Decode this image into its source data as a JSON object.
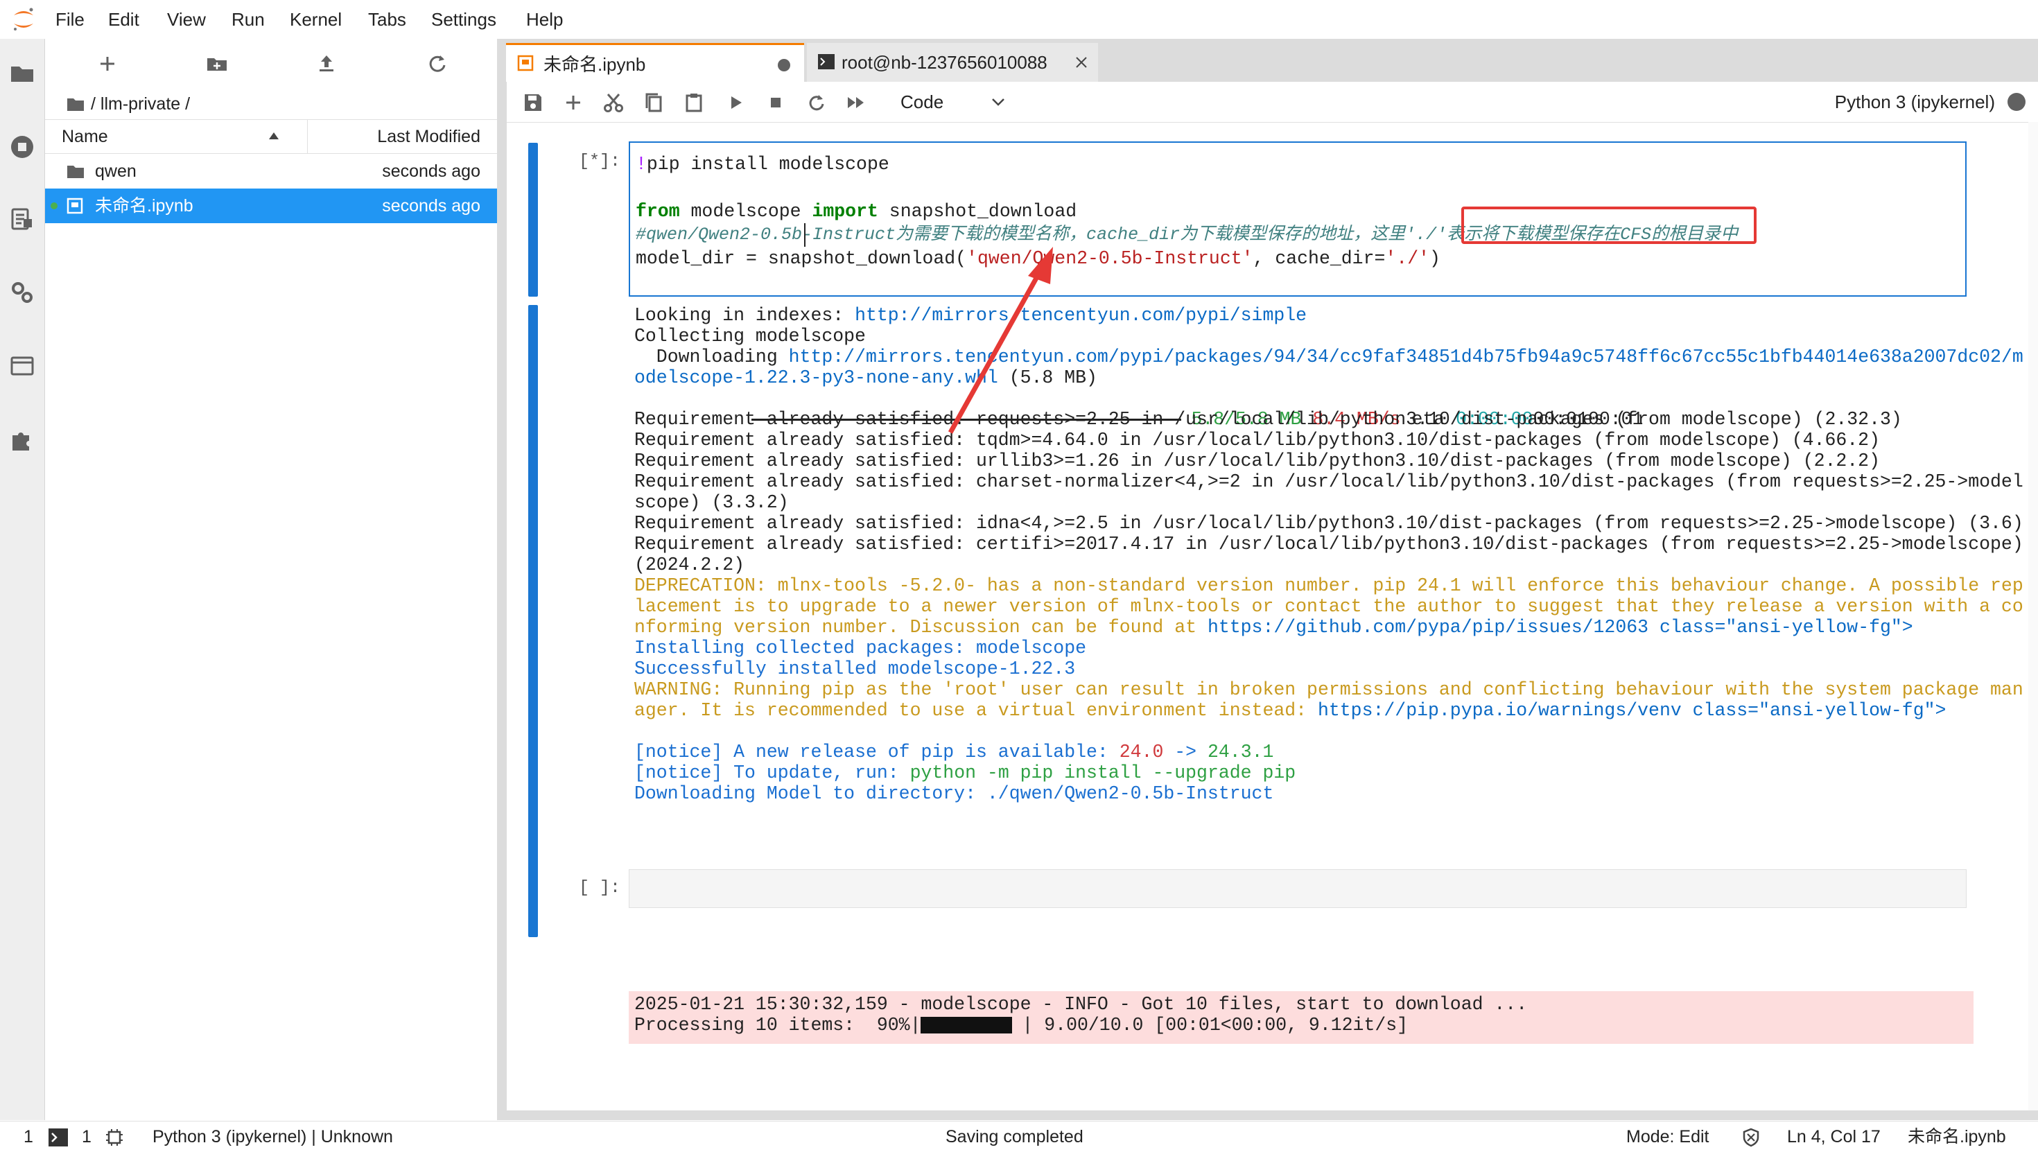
{
  "menubar": {
    "items": [
      "File",
      "Edit",
      "View",
      "Run",
      "Kernel",
      "Tabs",
      "Settings",
      "Help"
    ]
  },
  "activity_bar": {
    "icons": [
      "folder-icon",
      "running-icon",
      "commands-icon",
      "property-inspector-icon",
      "tabs-icon",
      "extensions-icon"
    ]
  },
  "file_browser": {
    "breadcrumb": "/ llm-private /",
    "columns": {
      "name": "Name",
      "modified": "Last Modified"
    },
    "rows": [
      {
        "name": "qwen",
        "modified": "seconds ago",
        "type": "folder",
        "selected": false
      },
      {
        "name": "未命名.ipynb",
        "modified": "seconds ago",
        "type": "notebook",
        "selected": true
      }
    ]
  },
  "tabs": [
    {
      "label": "未命名.ipynb",
      "active": true
    },
    {
      "label": "root@nb-1237656010088",
      "active": false
    }
  ],
  "toolbar": {
    "cell_type": "Code",
    "kernel": "Python 3 (ipykernel)"
  },
  "cells": {
    "input_prompt": "[*]:",
    "code_lines": {
      "l1_op": "!",
      "l1_rest": "pip install modelscope",
      "l2_from": "from",
      "l2_mid": " modelscope ",
      "l2_import": "import",
      "l2_end": " snapshot_download",
      "l3_comment": "#qwen/Qwen2-0.5b-Instruct为需要下载的模型名称，cache_dir为下载模型保存的地址，这里'./'表示将下载模型保存在CFS的根目录中",
      "l4_a": "model_dir = snapshot_download(",
      "l4_str": "'qwen/Qwen2-0.5b-Instruct'",
      "l4_b": ", cache_dir=",
      "l4_str2": "'./'",
      "l4_c": ")"
    },
    "output": {
      "o1_a": "Looking in indexes: ",
      "o1_link": "http://mirrors.tencentyun.com/pypi/simple",
      "o2": "Collecting modelscope",
      "o3_a": "  Downloading ",
      "o3_link": "http://mirrors.tencentyun.com/pypi/packages/94/34/cc9faf34851d4b75fb94a9c5748ff6c67cc55c1bfb44014e638a2007dc02/m",
      "o4_link": "odelscope-1.22.3-py3-none-any.whl",
      "o4_b": " (5.8 MB)",
      "o5_size": "5.8/5.8 MB",
      "o5_speed": "8.4 MB/s",
      "o5_eta": " eta ",
      "o5_time": "0:00:00",
      "o5_tail": "00:0100:01",
      "req": [
        "Requirement already satisfied: requests>=2.25 in /usr/local/lib/python3.10/dist-packages (from modelscope) (2.32.3)",
        "Requirement already satisfied: tqdm>=4.64.0 in /usr/local/lib/python3.10/dist-packages (from modelscope) (4.66.2)",
        "Requirement already satisfied: urllib3>=1.26 in /usr/local/lib/python3.10/dist-packages (from modelscope) (2.2.2)",
        "Requirement already satisfied: charset-normalizer<4,>=2 in /usr/local/lib/python3.10/dist-packages (from requests>=2.25->model",
        "scope) (3.3.2)",
        "Requirement already satisfied: idna<4,>=2.5 in /usr/local/lib/python3.10/dist-packages (from requests>=2.25->modelscope) (3.6)",
        "Requirement already satisfied: certifi>=2017.4.17 in /usr/local/lib/python3.10/dist-packages (from requests>=2.25->modelscope)",
        "(2024.2.2)"
      ],
      "dep1": "DEPRECATION: mlnx-tools -5.2.0- has a non-standard version number. pip 24.1 will enforce this behaviour change. A possible rep",
      "dep2": "lacement is to upgrade to a newer version of mlnx-tools or contact the author to suggest that they release a version with a co",
      "dep3_a": "nforming version number. Discussion can be found at ",
      "dep3_link": "https://github.com/pypa/pip/issues/12063 class=\"ansi-yellow-fg\">",
      "inst1": "Installing collected packages: modelscope",
      "inst2": "Successfully installed modelscope-1.22.3",
      "warn1": "WARNING: Running pip as the 'root' user can result in broken permissions and conflicting behaviour with the system package man",
      "warn2_a": "ager. It is recommended to use a virtual environment instead: ",
      "warn2_link": "https://pip.pypa.io/warnings/venv class=\"ansi-yellow-fg\">",
      "n1_a": "[notice]",
      "n1_b": " A new release of pip is available: ",
      "n1_old": "24.0",
      "n1_arrow": " -> ",
      "n1_new": "24.3.1",
      "n2_a": "[notice]",
      "n2_b": " To update, run: ",
      "n2_cmd": "python -m pip install --upgrade pip",
      "dl": "Downloading Model to directory: ./qwen/Qwen2-0.5b-Instruct",
      "err1": "2025-01-21 15:30:32,159 - modelscope - INFO - Got 10 files, start to download ...",
      "err2_a": "Processing 10 items:  90%|",
      "err2_b": "| 9.00/10.0 [00:01<00:00, 9.12it/s]",
      "progress_fraction": 0.9
    },
    "empty_prompt": "[ ]:"
  },
  "statusbar": {
    "terminals": "1",
    "kernels": "1",
    "kernel_status": "Python 3 (ipykernel) | Unknown",
    "message": "Saving completed",
    "mode": "Mode: Edit",
    "position": "Ln 4, Col 17",
    "filename": "未命名.ipynb"
  },
  "colors": {
    "accent": "#1976d2",
    "selection": "#2196f3",
    "highlight_box": "#e53935",
    "stderr_bg": "#fddddd"
  }
}
